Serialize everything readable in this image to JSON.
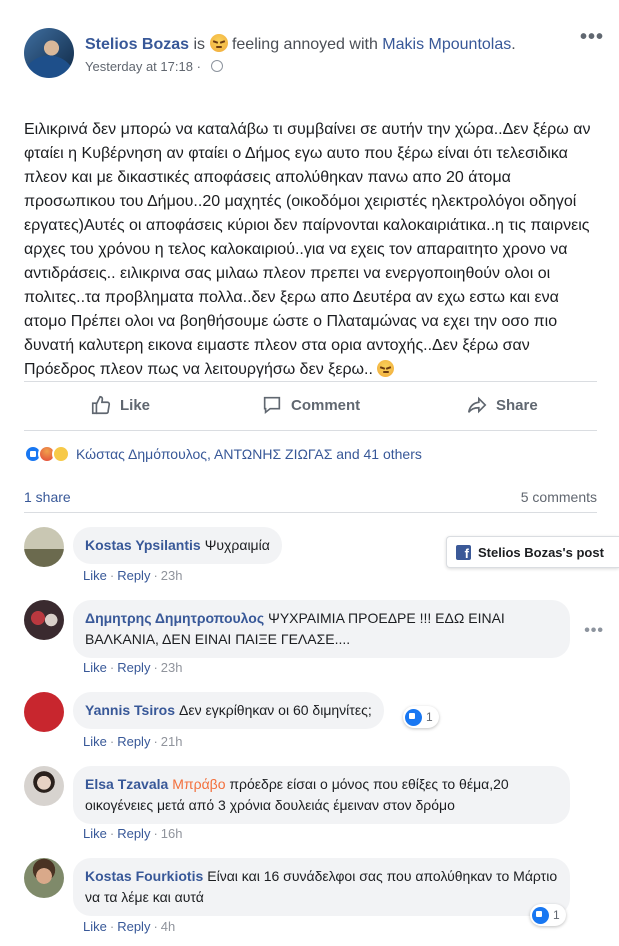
{
  "post": {
    "author": "Stelios Bozas",
    "verb": "is",
    "feeling": "feeling annoyed with",
    "tagged": "Makis Mpountolas",
    "tagged_end": ".",
    "timestamp": "Yesterday at 17:18",
    "timestamp_sep": "·",
    "more": "•••",
    "text": "Ειλικρινά δεν μπορώ να καταλάβω τι συμβαίνει σε αυτήν την χώρα..Δεν ξέρω αν φταίει η Κυβέρνηση αν φταίει ο Δήμος εγω αυτο που ξέρω είναι ότι τελεσιδικα πλεον και με δικαστικές αποφάσεις απολύθηκαν πανω απο 20 άτομα προσωπικου του Δήμου..20 μαχητές (οικοδόμοι χειριστές ηλεκτρολόγοι οδηγοί εργατες)Αυτές οι αποφάσεις κύριοι δεν παίρνονται καλοκαιριάτικα..η τις παιρνεις αρχες του χρόνου η τελος καλοκαιριού..για να εχεις τον απαραιτητο χρονο να αντιδράσεις.. ειλικρινα σας μιλαω πλεον πρεπει να ενεργοποιηθούν ολοι οι πολιτες..τα προβληματα πολλα..δεν ξερω απο Δευτέρα αν εχω εστω και ενα ατομο Πρέπει ολοι να βοηθήσουμε ώστε ο Πλαταμώνας να εχει την οσο πιο δυνατή καλυτερη εικονα ειμαστε πλεον στα ορια αντοχής..Δεν ξέρω σαν Πρόεδρος πλεον πως να λειτουργήσω δεν ξερω.."
  },
  "actions": {
    "like": "Like",
    "comment": "Comment",
    "share": "Share"
  },
  "reactions": {
    "icons": [
      "like-icon",
      "angry-icon",
      "sad-icon"
    ],
    "names": "Κώστας Δημόπουλος, ΑΝΤΩΝΗΣ ΖΙΩΓΑΣ and 41 others"
  },
  "stats": {
    "shares": "1 share",
    "comments": "5 comments"
  },
  "post_label": "Stelios Bozas's post",
  "comments": [
    {
      "author": "Kostas Ypsilantis",
      "text": "Ψυχραιμία",
      "like": "Like",
      "reply": "Reply",
      "time": "23h"
    },
    {
      "author": "Δημητρης Δημητροπουλος",
      "text": "ΨΥΧΡΑΙΜΙΑ ΠΡΟΕΔΡΕ !!! ΕΔΩ ΕΙΝΑΙ ΒΑΛΚΑΝΙΑ, ΔΕΝ ΕΙΝΑΙ ΠΑΙΞΕ ΓΕΛΑΣΕ....",
      "like": "Like",
      "reply": "Reply",
      "time": "23h"
    },
    {
      "author": "Yannis Tsiros",
      "text": "Δεν εγκρίθηκαν οι 60 διμηνίτες;",
      "like": "Like",
      "reply": "Reply",
      "time": "21h",
      "likes": "1"
    },
    {
      "author": "Elsa Tzavala",
      "highlight": "Μπράβο",
      "text": "πρόεδρε είσαι ο μόνος που εθίξες το θέμα,20 οικογένειες μετά από 3 χρόνια δουλειάς έμειναν στον δρόμο",
      "like": "Like",
      "reply": "Reply",
      "time": "16h"
    },
    {
      "author": "Kostas Fourkiotis",
      "text": "Είναι και 16 συνάδελφοι σας που απολύθηκαν το Μάρτιο να τα λέμε και αυτά",
      "like": "Like",
      "reply": "Reply",
      "time": "4h",
      "likes": "1"
    }
  ],
  "comment_more": "•••",
  "colors": {
    "link": "#385898",
    "like_blue": "#1877f2",
    "bubble": "#f2f3f5",
    "highlight": "#f36f3c"
  }
}
